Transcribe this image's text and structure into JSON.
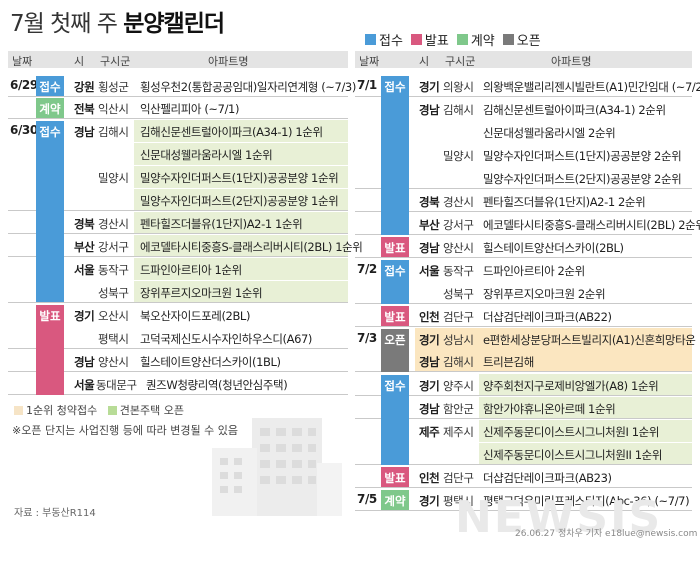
{
  "title": {
    "prefix": "7월 첫째 주 ",
    "main": "분양캘린더"
  },
  "legend": [
    {
      "label": "접수",
      "color": "#4a9bd8"
    },
    {
      "label": "발표",
      "color": "#d9587f"
    },
    {
      "label": "계약",
      "color": "#7fc88b"
    },
    {
      "label": "오픈",
      "color": "#7a7a7a"
    }
  ],
  "headers": {
    "date": "날짜",
    "province": "시",
    "city": "구시군",
    "apartment": "아파트명"
  },
  "colors": {
    "reception_bg": "#e8f0d6",
    "open_bg": "#fbe6c0",
    "header_bg": "#e4e4e4"
  },
  "left_table": {
    "dates": [
      "6/29",
      "6/30"
    ],
    "badges": [
      "접수",
      "계약",
      "접수",
      "발표"
    ],
    "rows": [
      {
        "province": "강원",
        "city": "횡성군",
        "apartment": "횡성우천2(통합공공임대)일자리연계형 (~7/3)"
      },
      {
        "province": "전북",
        "city": "익산시",
        "apartment": "익산펠리피아 (~7/1)"
      },
      {
        "province": "경남",
        "city": "김해시",
        "apartment": "김해신문센트럴아이파크(A34-1) 1순위"
      },
      {
        "province": "",
        "city": "",
        "apartment": "신문대성웰라움라시엘 1순위"
      },
      {
        "province": "",
        "city": "밀양시",
        "apartment": "밀양수자인더퍼스트(1단지)공공분양 1순위"
      },
      {
        "province": "",
        "city": "",
        "apartment": "밀양수자인더퍼스트(2단지)공공분양 1순위"
      },
      {
        "province": "경북",
        "city": "경산시",
        "apartment": "펜타힐즈더블유(1단지)A2-1 1순위"
      },
      {
        "province": "부산",
        "city": "강서구",
        "apartment": "에코델타시티중흥S-클래스리버시티(2BL) 1순위"
      },
      {
        "province": "서울",
        "city": "동작구",
        "apartment": "드파인아르티아 1순위"
      },
      {
        "province": "",
        "city": "성북구",
        "apartment": "장위푸르지오마크원 1순위"
      },
      {
        "province": "경기",
        "city": "오산시",
        "apartment": "북오산자이드포레(2BL)"
      },
      {
        "province": "",
        "city": "평택시",
        "apartment": "고덕국제신도시수자인하우스디(A67)"
      },
      {
        "province": "경남",
        "city": "양산시",
        "apartment": "힐스테이트양산더스카이(1BL)"
      },
      {
        "province": "서울",
        "city": "동대문구",
        "apartment": "퀀즈W청량리역(청년안심주택)"
      }
    ]
  },
  "right_table": {
    "dates": [
      "7/1",
      "7/2",
      "7/3",
      "7/5"
    ],
    "badges": [
      "접수",
      "발표",
      "접수",
      "발표",
      "오픈",
      "접수",
      "발표",
      "계약"
    ],
    "rows": [
      {
        "province": "경기",
        "city": "의왕시",
        "apartment": "의왕백운밸리리젠시빌란트(A1)민간임대 (~7/2)"
      },
      {
        "province": "경남",
        "city": "김해시",
        "apartment": "김해신문센트럴아이파크(A34-1) 2순위"
      },
      {
        "province": "",
        "city": "",
        "apartment": "신문대성웰라움라시엘 2순위"
      },
      {
        "province": "",
        "city": "밀양시",
        "apartment": "밀양수자인더퍼스트(1단지)공공분양 2순위"
      },
      {
        "province": "",
        "city": "",
        "apartment": "밀양수자인더퍼스트(2단지)공공분양 2순위"
      },
      {
        "province": "경북",
        "city": "경산시",
        "apartment": "펜타힐즈더블유(1단지)A2-1 2순위"
      },
      {
        "province": "부산",
        "city": "강서구",
        "apartment": "에코델타시티중흥S-클래스리버시티(2BL) 2순위"
      },
      {
        "province": "경남",
        "city": "양산시",
        "apartment": "힐스테이트양산더스카이(2BL)"
      },
      {
        "province": "서울",
        "city": "동작구",
        "apartment": "드파인아르티아 2순위"
      },
      {
        "province": "",
        "city": "성북구",
        "apartment": "장위푸르지오마크원 2순위"
      },
      {
        "province": "인천",
        "city": "검단구",
        "apartment": "더샵검단레이크파크(AB22)"
      },
      {
        "province": "경기",
        "city": "성남시",
        "apartment": "e편한세상분당퍼스트빌리지(A1)신혼희망타운"
      },
      {
        "province": "경남",
        "city": "김해시",
        "apartment": "트리븐김해"
      },
      {
        "province": "경기",
        "city": "양주시",
        "apartment": "양주회천지구로제비앙엘가(A8) 1순위"
      },
      {
        "province": "경남",
        "city": "함안군",
        "apartment": "함안가야휴니온아르떼 1순위"
      },
      {
        "province": "제주",
        "city": "제주시",
        "apartment": "신제주동문디이스트시그니처원I 1순위"
      },
      {
        "province": "",
        "city": "",
        "apartment": "신제주동문디이스트시그니처원II 1순위"
      },
      {
        "province": "인천",
        "city": "검단구",
        "apartment": "더샵검단레이크파크(AB23)"
      },
      {
        "province": "경기",
        "city": "평택시",
        "apartment": "평택고덕우미린프레스티지(Abc-36) (~7/7)"
      }
    ]
  },
  "notes": {
    "first_priority": "1순위 청약접수",
    "model_house": "견본주택 오픈",
    "disclaimer": "※오픈 단지는 사업진행 등에 따라 변경될 수 있음"
  },
  "source": "자료 : 부동산R114",
  "credit": "26.06.27 정차우 기자 e18lue@newsis.com",
  "watermark": "NEWSIS"
}
